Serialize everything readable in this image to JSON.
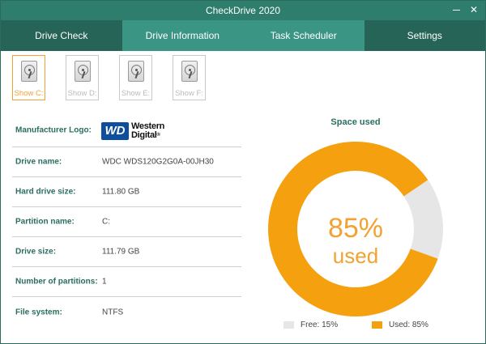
{
  "window": {
    "title": "CheckDrive 2020",
    "minimize_glyph": "",
    "close_glyph": "✕"
  },
  "tabs": [
    {
      "label": "Drive Check"
    },
    {
      "label": "Drive Information"
    },
    {
      "label": "Task Scheduler"
    },
    {
      "label": "Settings"
    }
  ],
  "drives": [
    {
      "label": "Show C:",
      "active": true
    },
    {
      "label": "Show D:",
      "active": false
    },
    {
      "label": "Show E:",
      "active": false
    },
    {
      "label": "Show F:",
      "active": false
    }
  ],
  "info": {
    "manufacturer_logo_label": "Manufacturer Logo:",
    "logo_mark": "WD",
    "logo_line1": "Western",
    "logo_line2": "Digital",
    "logo_registered": "®",
    "rows": [
      {
        "label": "Drive name:",
        "value": "WDC WDS120G2G0A-00JH30"
      },
      {
        "label": "Hard drive size:",
        "value": "111.80 GB"
      },
      {
        "label": "Partition name:",
        "value": "C:"
      },
      {
        "label": "Drive size:",
        "value": "111.79 GB"
      },
      {
        "label": "Number of partitions:",
        "value": "1"
      },
      {
        "label": "File system:",
        "value": "NTFS"
      }
    ]
  },
  "chart_data": {
    "type": "pie",
    "title": "Space used",
    "center_value": "85%",
    "center_label": "used",
    "categories": [
      "Free",
      "Used"
    ],
    "values": [
      15,
      85
    ],
    "legend": [
      "Free: 15%",
      "Used: 85%"
    ],
    "colors": {
      "Free": "#e6e6e6",
      "Used": "#f5a00f"
    },
    "legend_position": "bottom"
  },
  "colors": {
    "titlebar": "#2e7d6d",
    "tab_dark": "#256456",
    "tab_light": "#3a9584",
    "accent": "#f2a233",
    "label_text": "#2a6e60"
  }
}
